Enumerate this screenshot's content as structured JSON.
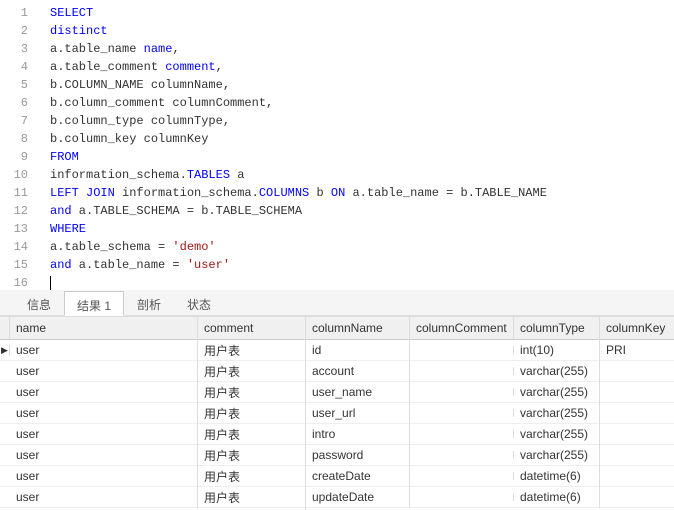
{
  "editor": {
    "lines": [
      [
        {
          "t": "kw",
          "v": "SELECT"
        }
      ],
      [
        {
          "t": "kw",
          "v": "distinct"
        }
      ],
      [
        {
          "t": "plain",
          "v": "a.table_name "
        },
        {
          "t": "ident",
          "v": "name"
        },
        {
          "t": "plain",
          "v": ","
        }
      ],
      [
        {
          "t": "plain",
          "v": "a.table_comment "
        },
        {
          "t": "ident",
          "v": "comment"
        },
        {
          "t": "plain",
          "v": ","
        }
      ],
      [
        {
          "t": "plain",
          "v": "b.COLUMN_NAME columnName,"
        }
      ],
      [
        {
          "t": "plain",
          "v": "b.column_comment columnComment,"
        }
      ],
      [
        {
          "t": "plain",
          "v": "b.column_type columnType,"
        }
      ],
      [
        {
          "t": "plain",
          "v": "b.column_key columnKey"
        }
      ],
      [
        {
          "t": "kw",
          "v": "FROM"
        }
      ],
      [
        {
          "t": "plain",
          "v": "information_schema."
        },
        {
          "t": "ident",
          "v": "TABLES"
        },
        {
          "t": "plain",
          "v": " a"
        }
      ],
      [
        {
          "t": "kw",
          "v": "LEFT JOIN"
        },
        {
          "t": "plain",
          "v": " information_schema."
        },
        {
          "t": "ident",
          "v": "COLUMNS"
        },
        {
          "t": "plain",
          "v": " b "
        },
        {
          "t": "kw",
          "v": "ON"
        },
        {
          "t": "plain",
          "v": " a.table_name = b.TABLE_NAME"
        }
      ],
      [
        {
          "t": "kw",
          "v": "and"
        },
        {
          "t": "plain",
          "v": " a.TABLE_SCHEMA = b.TABLE_SCHEMA"
        }
      ],
      [
        {
          "t": "kw",
          "v": "WHERE"
        }
      ],
      [
        {
          "t": "plain",
          "v": "a.table_schema = "
        },
        {
          "t": "str",
          "v": "'demo'"
        }
      ],
      [
        {
          "t": "kw",
          "v": "and"
        },
        {
          "t": "plain",
          "v": " a.table_name = "
        },
        {
          "t": "str",
          "v": "'user'"
        }
      ],
      [
        {
          "t": "cursor",
          "v": ""
        }
      ]
    ]
  },
  "tabs": {
    "items": [
      {
        "label": "信息"
      },
      {
        "label": "结果 1"
      },
      {
        "label": "剖析"
      },
      {
        "label": "状态"
      }
    ],
    "activeIndex": 1
  },
  "table": {
    "headers": {
      "name": "name",
      "comment": "comment",
      "columnName": "columnName",
      "columnComment": "columnComment",
      "columnType": "columnType",
      "columnKey": "columnKey"
    },
    "rows": [
      {
        "marker": "▶",
        "name": "user",
        "comment": "用户表",
        "columnName": "id",
        "columnComment": "",
        "columnType": "int(10)",
        "columnKey": "PRI"
      },
      {
        "marker": "",
        "name": "user",
        "comment": "用户表",
        "columnName": "account",
        "columnComment": "",
        "columnType": "varchar(255)",
        "columnKey": ""
      },
      {
        "marker": "",
        "name": "user",
        "comment": "用户表",
        "columnName": "user_name",
        "columnComment": "",
        "columnType": "varchar(255)",
        "columnKey": ""
      },
      {
        "marker": "",
        "name": "user",
        "comment": "用户表",
        "columnName": "user_url",
        "columnComment": "",
        "columnType": "varchar(255)",
        "columnKey": ""
      },
      {
        "marker": "",
        "name": "user",
        "comment": "用户表",
        "columnName": "intro",
        "columnComment": "",
        "columnType": "varchar(255)",
        "columnKey": ""
      },
      {
        "marker": "",
        "name": "user",
        "comment": "用户表",
        "columnName": "password",
        "columnComment": "",
        "columnType": "varchar(255)",
        "columnKey": ""
      },
      {
        "marker": "",
        "name": "user",
        "comment": "用户表",
        "columnName": "createDate",
        "columnComment": "",
        "columnType": "datetime(6)",
        "columnKey": ""
      },
      {
        "marker": "",
        "name": "user",
        "comment": "用户表",
        "columnName": "updateDate",
        "columnComment": "",
        "columnType": "datetime(6)",
        "columnKey": ""
      }
    ]
  }
}
